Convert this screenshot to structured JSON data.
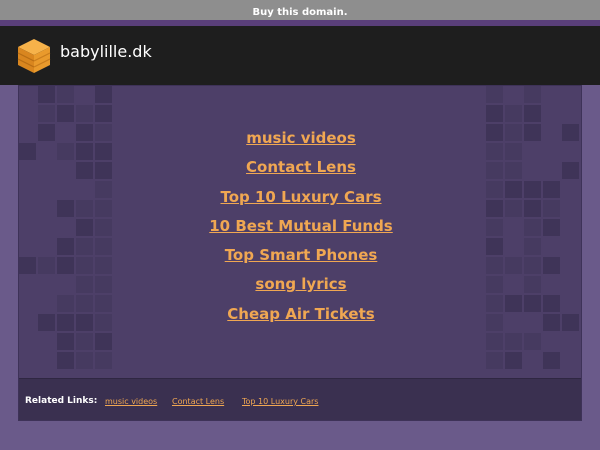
{
  "topbar": {
    "buy_label": "Buy this domain."
  },
  "header": {
    "site_name": "babylille.dk",
    "logo_icon": "orange-cube-stack-icon"
  },
  "main": {
    "links": [
      "music videos",
      "Contact Lens",
      "Top 10 Luxury Cars",
      "10 Best Mutual Funds",
      "Top Smart Phones",
      "song lyrics",
      "Cheap Air Tickets"
    ]
  },
  "related": {
    "label": "Related Links:",
    "links": [
      "music videos",
      "Contact Lens",
      "Top 10 Luxury Cars"
    ]
  },
  "colors": {
    "link": "#f0a752",
    "header_bg": "#1e1e1e",
    "page_bg": "#6a5a8a",
    "panel_bg": "#4d3f68"
  }
}
